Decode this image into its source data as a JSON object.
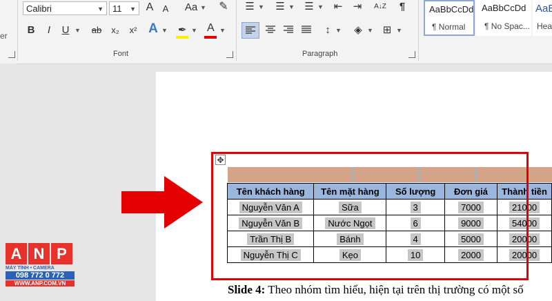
{
  "ribbon": {
    "font_name": "Calibri",
    "font_size": "11",
    "font_label": "Font",
    "paragraph_label": "Paragraph",
    "left_cutoff": "er",
    "bold": "B",
    "italic": "I",
    "underline": "U",
    "strike": "ab",
    "subscript": "x₂",
    "superscript": "x²",
    "grow": "A",
    "shrink": "A",
    "case": "Aa",
    "sort": "A↓Z",
    "pilcrow": "¶",
    "styles": [
      {
        "sample": "AaBbCcDd",
        "name": "¶ Normal"
      },
      {
        "sample": "AaBbCcDd",
        "name": "¶ No Spac..."
      },
      {
        "sample": "AaB",
        "name": "Hea"
      }
    ]
  },
  "table": {
    "headers": [
      "Tên khách hàng",
      "Tên mặt hàng",
      "Số lượng",
      "Đơn giá",
      "Thành tiền"
    ],
    "rows": [
      [
        "Nguyễn Văn A",
        "Sữa",
        "3",
        "7000",
        "21000"
      ],
      [
        "Nguyễn Văn B",
        "Nước Ngọt",
        "6",
        "9000",
        "54000"
      ],
      [
        "Trần Thị B",
        "Bánh",
        "4",
        "5000",
        "20000"
      ],
      [
        "Nguyễn Thị C",
        "Kẹo",
        "10",
        "2000",
        "20000"
      ]
    ]
  },
  "document": {
    "slide_label": "Slide 4:",
    "slide_text": " Theo nhóm tìm hiểu, hiện tại trên thị trường có một số"
  },
  "logo": {
    "letters": [
      "A",
      "N",
      "P"
    ],
    "line1": "MÁY TÍNH • CAMERA",
    "line2": "098 772 0 772",
    "line3": "WWW.ANP.COM.VN"
  },
  "colors": {
    "highlight_red": "#e40000",
    "header_fill": "#9bb6dd",
    "top_row_fill": "#d4a488",
    "logo_red": "#e8312b",
    "logo_blue": "#2a62b8"
  }
}
